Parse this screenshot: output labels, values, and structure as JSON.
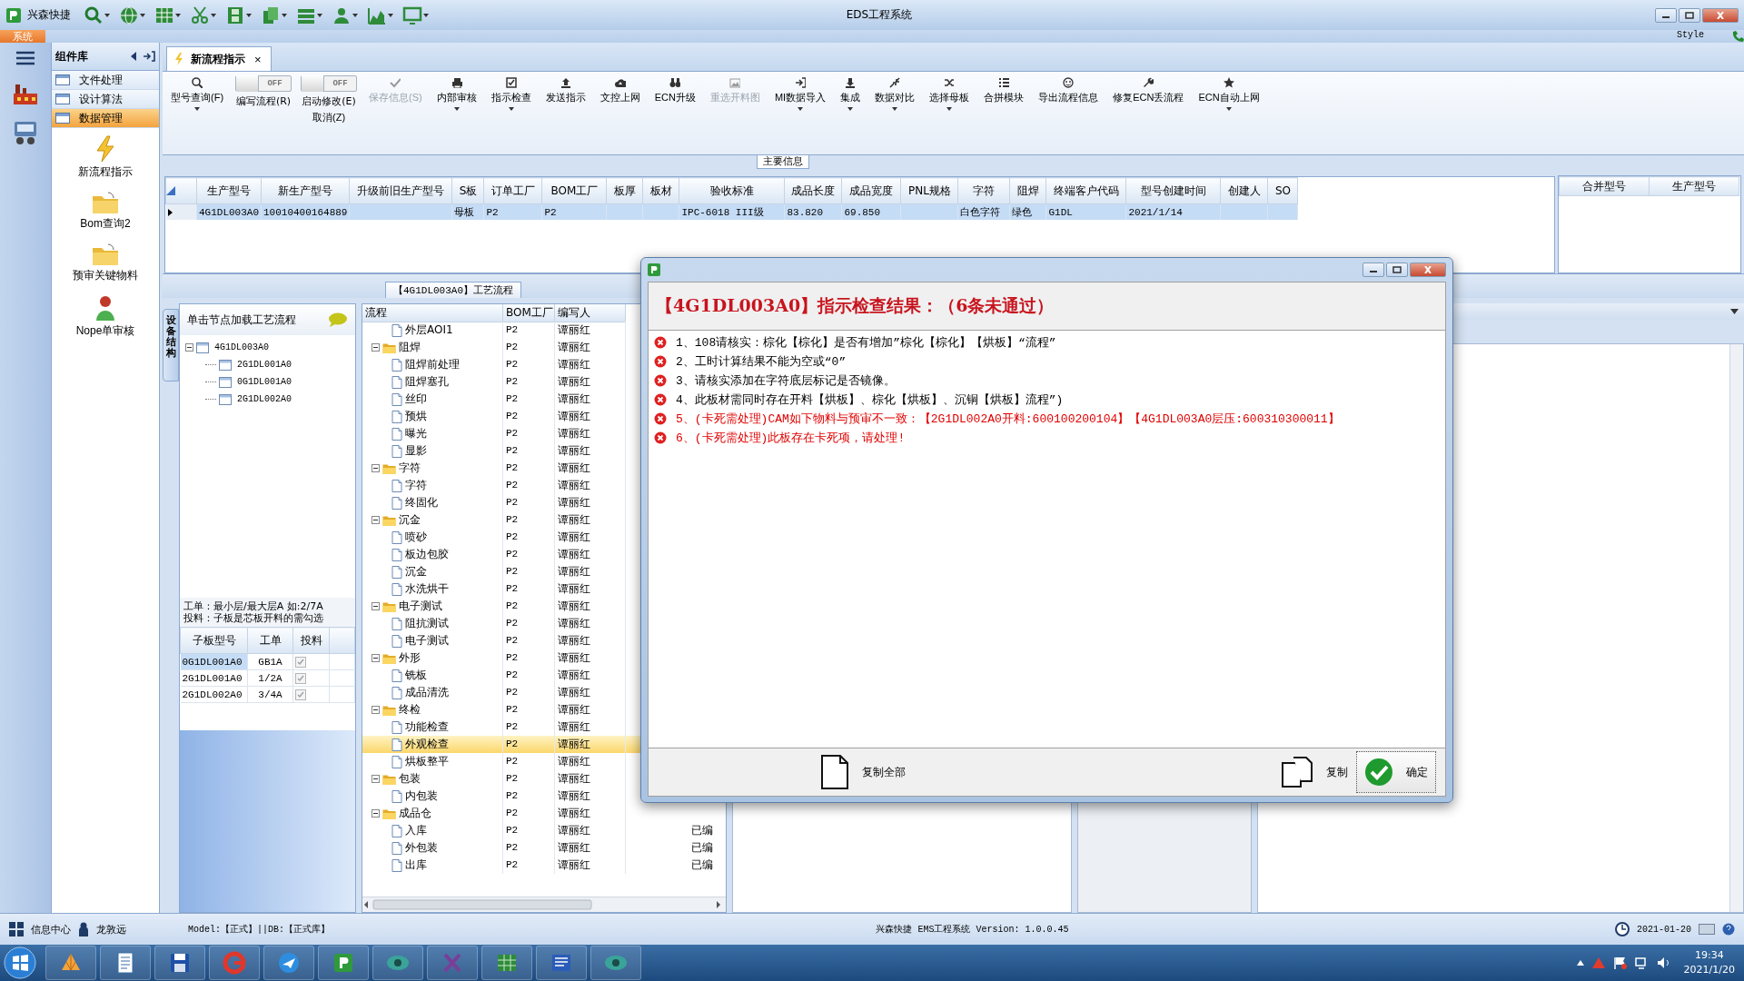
{
  "window": {
    "app_name": "兴森快捷",
    "title": "EDS工程系统"
  },
  "ribbon": {
    "tab": "系统",
    "style_label": "Style"
  },
  "component_library": {
    "title": "组件库",
    "categories": [
      {
        "label": "文件处理",
        "selected": false
      },
      {
        "label": "设计算法",
        "selected": false
      },
      {
        "label": "数据管理",
        "selected": true
      }
    ],
    "tools": [
      {
        "label": "新流程指示"
      },
      {
        "label": "Bom查询2"
      },
      {
        "label": "预审关键物料"
      },
      {
        "label": "Nope单审核"
      }
    ]
  },
  "document_tabs": [
    {
      "label": "新流程指示",
      "selected": true,
      "close": "×"
    }
  ],
  "toolbar": [
    {
      "kind": "button",
      "label": "型号查询(F)",
      "dropdown": true,
      "disabled": false
    },
    {
      "kind": "toggle",
      "label": "编写流程(R)",
      "state_text": "OFF",
      "on": false
    },
    {
      "kind": "toggle",
      "label": "启动修改(E)",
      "state_text": "OFF",
      "on": false,
      "sublabel": "取消(Z)"
    },
    {
      "kind": "button",
      "label": "保存信息(S)",
      "dropdown": false,
      "disabled": true
    },
    {
      "kind": "button",
      "label": "内部审核",
      "dropdown": true,
      "disabled": false
    },
    {
      "kind": "button",
      "label": "指示检查",
      "dropdown": true,
      "disabled": false
    },
    {
      "kind": "button",
      "label": "发送指示",
      "dropdown": false,
      "disabled": false
    },
    {
      "kind": "button",
      "label": "文控上网",
      "dropdown": false,
      "disabled": false
    },
    {
      "kind": "button",
      "label": "ECN升级",
      "dropdown": false,
      "disabled": false
    },
    {
      "kind": "button",
      "label": "重选开料图",
      "dropdown": false,
      "disabled": true
    },
    {
      "kind": "button",
      "label": "MI数据导入",
      "dropdown": true,
      "disabled": false
    },
    {
      "kind": "button",
      "label": "集成",
      "dropdown": true,
      "disabled": false
    },
    {
      "kind": "button",
      "label": "数据对比",
      "dropdown": true,
      "disabled": false
    },
    {
      "kind": "button",
      "label": "选择母板",
      "dropdown": true,
      "disabled": false
    },
    {
      "kind": "button",
      "label": "合拼模块",
      "dropdown": false,
      "disabled": false
    },
    {
      "kind": "button",
      "label": "导出流程信息",
      "dropdown": false,
      "disabled": false
    },
    {
      "kind": "button",
      "label": "修复ECN丢流程",
      "dropdown": false,
      "disabled": false
    },
    {
      "kind": "button",
      "label": "ECN自动上网",
      "dropdown": true,
      "disabled": false
    }
  ],
  "main_info": {
    "title": "主要信息",
    "columns": [
      "生产型号",
      "新生产型号",
      "升级前旧生产型号",
      "S板",
      "订单工厂",
      "BOM工厂",
      "板厚",
      "板材",
      "验收标准",
      "成品长度",
      "成品宽度",
      "PNL规格",
      "字符",
      "阻焊",
      "终端客户代码",
      "型号创建时间",
      "创建人",
      "SO"
    ],
    "rows": [
      {
        "selected": true,
        "cells": [
          "4G1DL003A0",
          "10010400164889",
          null,
          "母板",
          "P2",
          "P2",
          null,
          null,
          "IPC-6018 III级",
          "83.820",
          "69.850",
          null,
          "白色字符",
          "绿色",
          "G1DL",
          "2021/1/14",
          null,
          null
        ]
      }
    ]
  },
  "merge_table": {
    "columns": [
      "合并型号",
      "生产型号"
    ]
  },
  "process_panel": {
    "title": "【4G1DL003A0】工艺流程",
    "side_tab": "设备结构",
    "hint": "单击节点加载工艺流程",
    "board_tree": [
      {
        "label": "4G1DL003A0",
        "expanded": true,
        "children": [
          {
            "label": "2G1DL001A0"
          },
          {
            "label": "0G1DL001A0"
          },
          {
            "label": "2G1DL002A0"
          }
        ]
      }
    ],
    "note": [
      "工单：最小层/最大层A 如:2/7A",
      "投料：子板是芯板开料的需勾选"
    ],
    "subboards": {
      "columns": [
        "子板型号",
        "工单",
        "投料"
      ],
      "rows": [
        {
          "model": "0G1DL001A0",
          "order": "GB1A",
          "feed": true,
          "selected": true
        },
        {
          "model": "2G1DL001A0",
          "order": "1/2A",
          "feed": true,
          "selected": false
        },
        {
          "model": "2G1DL002A0",
          "order": "3/4A",
          "feed": true,
          "selected": false
        }
      ]
    },
    "process_columns": [
      "流程",
      "BOM工厂",
      "编写人"
    ],
    "process_tree": [
      {
        "kind": "step",
        "name": "外层AOI1",
        "bom": "P2",
        "writer": "谭丽红",
        "selected": false
      },
      {
        "kind": "group",
        "name": "阻焊",
        "bom": "P2",
        "writer": "谭丽红",
        "selected": false,
        "expanded": true,
        "children": [
          {
            "kind": "step",
            "name": "阻焊前处理",
            "bom": "P2",
            "writer": "谭丽红",
            "selected": false
          },
          {
            "kind": "step",
            "name": "阻焊塞孔",
            "bom": "P2",
            "writer": "谭丽红",
            "selected": false
          },
          {
            "kind": "step",
            "name": "丝印",
            "bom": "P2",
            "writer": "谭丽红",
            "selected": false
          },
          {
            "kind": "step",
            "name": "预烘",
            "bom": "P2",
            "writer": "谭丽红",
            "selected": false
          },
          {
            "kind": "step",
            "name": "曝光",
            "bom": "P2",
            "writer": "谭丽红",
            "selected": false
          },
          {
            "kind": "step",
            "name": "显影",
            "bom": "P2",
            "writer": "谭丽红",
            "selected": false
          }
        ]
      },
      {
        "kind": "group",
        "name": "字符",
        "bom": "P2",
        "writer": "谭丽红",
        "selected": false,
        "expanded": true,
        "children": [
          {
            "kind": "step",
            "name": "字符",
            "bom": "P2",
            "writer": "谭丽红",
            "selected": false
          },
          {
            "kind": "step",
            "name": "终固化",
            "bom": "P2",
            "writer": "谭丽红",
            "selected": false
          }
        ]
      },
      {
        "kind": "group",
        "name": "沉金",
        "bom": "P2",
        "writer": "谭丽红",
        "selected": false,
        "expanded": true,
        "children": [
          {
            "kind": "step",
            "name": "喷砂",
            "bom": "P2",
            "writer": "谭丽红",
            "selected": false
          },
          {
            "kind": "step",
            "name": "板边包胶",
            "bom": "P2",
            "writer": "谭丽红",
            "selected": false
          },
          {
            "kind": "step",
            "name": "沉金",
            "bom": "P2",
            "writer": "谭丽红",
            "selected": false
          },
          {
            "kind": "step",
            "name": "水洗烘干",
            "bom": "P2",
            "writer": "谭丽红",
            "selected": false
          }
        ]
      },
      {
        "kind": "group",
        "name": "电子测试",
        "bom": "P2",
        "writer": "谭丽红",
        "selected": false,
        "expanded": true,
        "children": [
          {
            "kind": "step",
            "name": "阻抗测试",
            "bom": "P2",
            "writer": "谭丽红",
            "selected": false
          },
          {
            "kind": "step",
            "name": "电子测试",
            "bom": "P2",
            "writer": "谭丽红",
            "selected": false
          }
        ]
      },
      {
        "kind": "group",
        "name": "外形",
        "bom": "P2",
        "writer": "谭丽红",
        "selected": false,
        "expanded": true,
        "children": [
          {
            "kind": "step",
            "name": "铣板",
            "bom": "P2",
            "writer": "谭丽红",
            "selected": false
          },
          {
            "kind": "step",
            "name": "成品清洗",
            "bom": "P2",
            "writer": "谭丽红",
            "selected": false
          }
        ]
      },
      {
        "kind": "group",
        "name": "终检",
        "bom": "P2",
        "writer": "谭丽红",
        "selected": false,
        "expanded": true,
        "children": [
          {
            "kind": "step",
            "name": "功能检查",
            "bom": "P2",
            "writer": "谭丽红",
            "selected": false
          },
          {
            "kind": "step",
            "name": "外观检查",
            "bom": "P2",
            "writer": "谭丽红",
            "selected": true
          },
          {
            "kind": "step",
            "name": "烘板整平",
            "bom": "P2",
            "writer": "谭丽红",
            "selected": false
          }
        ]
      },
      {
        "kind": "group",
        "name": "包装",
        "bom": "P2",
        "writer": "谭丽红",
        "selected": false,
        "expanded": true,
        "children": [
          {
            "kind": "step",
            "name": "内包装",
            "bom": "P2",
            "writer": "谭丽红",
            "selected": false
          }
        ]
      },
      {
        "kind": "group",
        "name": "成品仓",
        "bom": "P2",
        "writer": "谭丽红",
        "selected": false,
        "expanded": true,
        "children": [
          {
            "kind": "step",
            "name": "入库",
            "bom": "P2",
            "writer": "谭丽红",
            "selected": false,
            "status": "已编"
          },
          {
            "kind": "step",
            "name": "外包装",
            "bom": "P2",
            "writer": "谭丽红",
            "selected": false,
            "status": "已编"
          },
          {
            "kind": "step",
            "name": "出库",
            "bom": "P2",
            "writer": "谭丽红",
            "selected": false,
            "status": "已编"
          }
        ]
      }
    ]
  },
  "dialog": {
    "heading": "【4G1DL003A0】指示检查结果：（6条未通过）",
    "messages": [
      {
        "text": "1、108请核实：棕化【棕化】是否有增加”棕化【棕化】【烘板】“流程”",
        "color": "#000000"
      },
      {
        "text": "2、工时计算结果不能为空或“0”",
        "color": "#000000"
      },
      {
        "text": "3、请核实添加在字符底层标记是否镜像。",
        "color": "#000000"
      },
      {
        "text": "4、此板材需同时存在开料【烘板】、棕化【烘板】、沉铜【烘板】流程”)",
        "color": "#000000"
      },
      {
        "text": "5、(卡死需处理)CAM如下物料与预审不一致：【2G1DL002A0开料:600100200104】【4G1DL003A0层压:600310300011】",
        "color": "#e00000"
      },
      {
        "text": "6、(卡死需处理)此板存在卡死项，请处理!",
        "color": "#e00000"
      }
    ],
    "buttons": [
      {
        "kind": "copy_all",
        "label": "复制全部",
        "selected": false
      },
      {
        "kind": "copy",
        "label": "复制",
        "selected": false
      },
      {
        "kind": "ok",
        "label": "确定",
        "selected": true
      }
    ]
  },
  "status_bar": {
    "info": "信息中心",
    "user": "龙敦远",
    "model": "Model:【正式】||DB:【正式库】",
    "version": "兴森快捷 EMS工程系统 Version: 1.0.0.45",
    "date": "2021-01-20"
  },
  "taskbar": {
    "time": "19:34",
    "date": "2021/1/20"
  }
}
